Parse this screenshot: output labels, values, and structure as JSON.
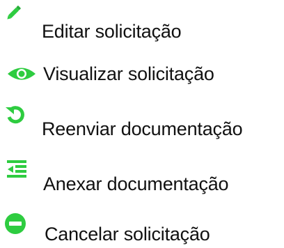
{
  "actions": {
    "edit": {
      "label": "Editar solicitação",
      "icon": "pencil-icon",
      "color": "#22c55e"
    },
    "view": {
      "label": "Visualizar solicitação",
      "icon": "eye-icon",
      "color": "#22c55e"
    },
    "resend": {
      "label": "Reenviar documentação",
      "icon": "undo-icon",
      "color": "#22c55e"
    },
    "attach": {
      "label": "Anexar documentação",
      "icon": "indent-list-icon",
      "color": "#22c55e"
    },
    "cancel": {
      "label": "Cancelar solicitação",
      "icon": "minus-circle-icon",
      "color": "#22c55e"
    }
  }
}
